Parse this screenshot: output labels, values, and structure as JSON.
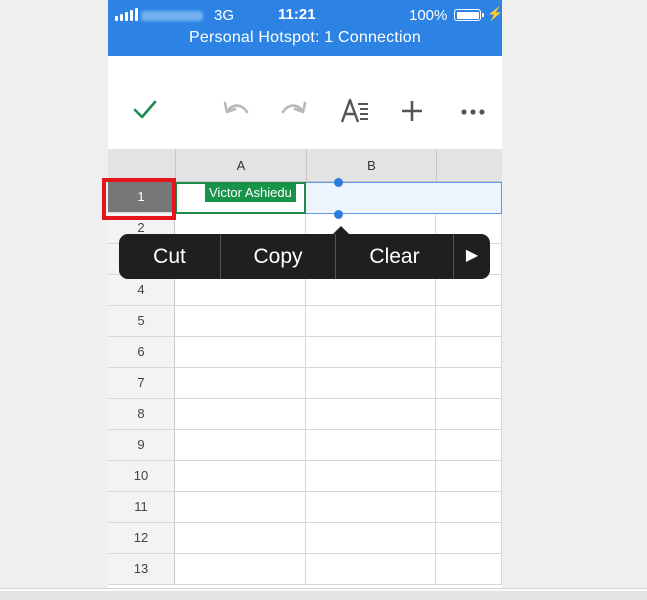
{
  "status_bar": {
    "network": "3G",
    "time": "11:21",
    "battery": "100%",
    "hotspot": "Personal Hotspot: 1 Connection"
  },
  "toolbar": {
    "icons": [
      "checkmark-icon",
      "undo-icon",
      "redo-icon",
      "text-format-icon",
      "add-icon",
      "more-icon"
    ],
    "accent_color": "#1e8a4c"
  },
  "sheet": {
    "columns": [
      "A",
      "B",
      ""
    ],
    "rows": [
      "1",
      "2",
      "3",
      "4",
      "5",
      "6",
      "7",
      "8",
      "9",
      "10",
      "11",
      "12",
      "13"
    ],
    "active_cell_value": "Victor Ashiedu"
  },
  "context_menu": {
    "items": [
      "Cut",
      "Copy",
      "Clear"
    ],
    "more_glyph": "▶"
  },
  "colors": {
    "status_bar": "#2d83e4",
    "selection": "#2e7be0",
    "cell_fill": "#18934a",
    "highlight": "#e5161b"
  }
}
